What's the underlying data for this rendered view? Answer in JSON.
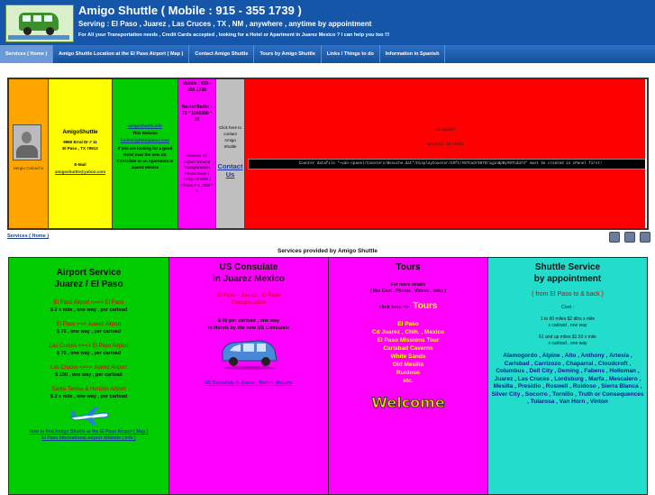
{
  "header": {
    "title": "Amigo Shuttle ( Mobile : 915 - 355 1739 )",
    "serving": "Serving : El Paso , Juarez , Las Cruces , TX , NM , anywhere , anytime by appointment",
    "tagline": "For All your Transportation needs , Credit Cards accepted , looking for a Hotel or Apartment in Juarez Mexico ? I can help you too !!!"
  },
  "nav": [
    "Services ( Home )",
    "Amigo Shuttle Location at the El Paso Airport ( Map )",
    "Contact Amigo Shuttle",
    "Tours by Amigo Shuttle",
    "Links / Things to do",
    "Information in Spanish"
  ],
  "banner": {
    "person_name": "Sergio Camacho",
    "company": "AmigoShuttle",
    "address1": "9960 Erral Dr # 11",
    "address2": "El Paso , TX 79912",
    "email_label": "E-Mail",
    "email": "amigoshuttle@yahoo.com",
    "site_link": "amigoshuttle.info",
    "site_text": "This Website",
    "hotel_link": "hotelsnightsinjuarez.com",
    "hotel_text": "If you are looking for a good Hotel near the new US Consulate or an Apartment in Juarez Mexico",
    "mobile": "Mobile : 915 - 355 1739",
    "nextel": "Nextel Radio : 72 * 1046390 * 10",
    "airport_text": "Services Inf. Airport Ground Transportation Phone Bank ( Amigo Shuttle ) Phone # 3 , Dial * 9",
    "contact_text": "Click here to contact Amigo Shuttle",
    "contact_link": "Contact Us",
    "counter_title": "Hit Counter",
    "counter_since": "Since 01 / 10 / 2009",
    "counter_code": "Counter datafile \"~van-cpanel/Counters/Besuche.dat\"/DisplayCounter/C0ft/#07Cedr507Origin8pBy#07CddrH\" must be created in cPanel first!"
  },
  "crumb": "Services ( Home )",
  "provided": "Services provided by Amigo Shuttle",
  "airport": {
    "title1": "Airport Service",
    "title2": "Juarez / El Paso",
    "routes": [
      {
        "route": "El Paso Airport <==> El Paso",
        "price": "$ 2 x mile , one way , per carload"
      },
      {
        "route": "El Paso ==> Juarez Airport",
        "price": "$ 75 , one way , per carload"
      },
      {
        "route": "Las Cruces <==> El Paso Airport",
        "price": "$ 75 , one way , per carload"
      },
      {
        "route": "Las Cruces <==> Juarez Airport",
        "price": "$ 150 , one way , per carload"
      },
      {
        "route": "Santa Teresa & Horizon Airport",
        "price": "$ 2 x mile , one way , per carload"
      }
    ],
    "link1": "How to find Amigo Shuttle at the El Paso Airport ( Map )",
    "link2": "El Paso International Airport Website ( Info )"
  },
  "consulate": {
    "title1": "US Consulate",
    "title2": "in Juarez Mexico",
    "route1": "El Paso - Juarez - El Paso",
    "route2": "Transportation",
    "price1": "$ 60 per carload , one way",
    "price2": "to Hotels by the new US Consulate",
    "link": "US Consulate in Juarez , Mexico Website"
  },
  "tours": {
    "title": "Tours",
    "details1": "For more details",
    "details2": "( like Cost , Photos , Videos , links )",
    "click": "click here =>",
    "click_big": "Tours",
    "places": [
      "El Paso",
      "Cd Juarez , Chih. , Mexico",
      "El Paso Missions Tour",
      "Carlsbad Caverns",
      "White Sands",
      "Old Mesilla",
      "Ruidoso",
      "etc."
    ],
    "welcome": "Welcome"
  },
  "shuttle": {
    "title1": "Shuttle Service",
    "title2": "by appointment",
    "from": "( from El Paso to & back )",
    "cost": "Cost :",
    "rate1a": "1 to 60 miles $2 dllrs x mile",
    "rate1b": "x carload , one way",
    "rate2a": "61 and up miles $1.50 x mile",
    "rate2b": "x carload , one way",
    "cities": "Alamogordo , Alpine , Alto , Anthony , Artesia , Carlsbad , Carrizozo , Chaparral , Cloudcroft , Columbus , Dell City , Deming , Fabens , Holloman , Juarez , Las Cruces , Lordsburg , Marfa , Mescalero , Mesilla , Presidio , Roswell , Ruidoso , Sierra Blanca , Silver City , Socorro , Tornillo , Truth or Consequences , Tularosa , Van Horn , Vinton"
  },
  "colors": {
    "header_bg": "#1556a8",
    "orange": "#ffa500",
    "yellow": "#ffff00",
    "green": "#00cc00",
    "magenta": "#ff00ff",
    "gray": "#bfbfbf",
    "red": "#ff0000",
    "cyan": "#22ddcc"
  }
}
